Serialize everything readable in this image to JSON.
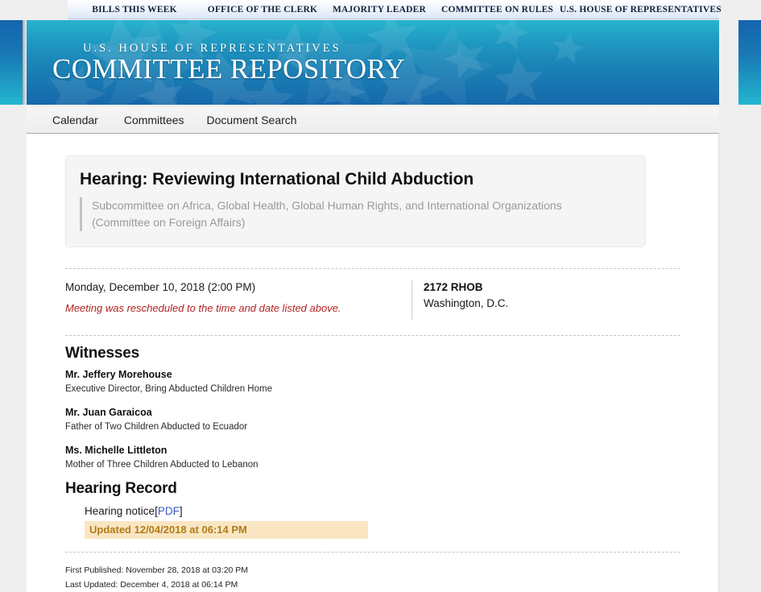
{
  "topnav": {
    "items": [
      {
        "label": "BILLS THIS WEEK"
      },
      {
        "label": "OFFICE OF THE CLERK"
      },
      {
        "label": "MAJORITY LEADER"
      },
      {
        "label": "COMMITTEE ON RULES"
      },
      {
        "label": "U.S. HOUSE OF REPRESENTATIVES"
      }
    ]
  },
  "banner": {
    "eyebrow": "U.S. HOUSE OF REPRESENTATIVES",
    "title": "COMMITTEE REPOSITORY",
    "gradient_from": "#27b3cd",
    "gradient_to": "#1668ab"
  },
  "subnav": {
    "items": [
      {
        "label": "Calendar"
      },
      {
        "label": "Committees"
      },
      {
        "label": "Document Search"
      }
    ]
  },
  "hearing": {
    "title": "Hearing: Reviewing International Child Abduction",
    "subtitle_line1": "Subcommittee on Africa, Global Health, Global Human Rights, and International Organizations",
    "subtitle_line2": "(Committee on Foreign Affairs)"
  },
  "meta": {
    "date": "Monday, December 10, 2018 (2:00 PM)",
    "note": "Meeting was rescheduled to the time and date listed above.",
    "note_color": "#b22222",
    "room": "2172 RHOB",
    "city": "Washington, D.C."
  },
  "witnesses": {
    "heading": "Witnesses",
    "items": [
      {
        "name": "Mr. Jeffery Morehouse",
        "role": "Executive Director, Bring Abducted Children Home"
      },
      {
        "name": "Mr. Juan Garaicoa",
        "role": "Father of Two Children Abducted to Ecuador"
      },
      {
        "name": "Ms. Michelle Littleton",
        "role": "Mother of Three Children Abducted to Lebanon"
      }
    ]
  },
  "record": {
    "heading": "Hearing Record",
    "document_label": "Hearing notice",
    "link_label": "PDF",
    "link_open": "[",
    "link_close": "]",
    "updated_badge": "Updated 12/04/2018 at 06:14 PM",
    "badge_bg": "#fae6c3",
    "badge_fg": "#b07d18"
  },
  "stamps": {
    "first_published": "First Published: November 28, 2018 at 03:20 PM",
    "last_updated": "Last Updated: December 4, 2018 at 06:14 PM"
  }
}
